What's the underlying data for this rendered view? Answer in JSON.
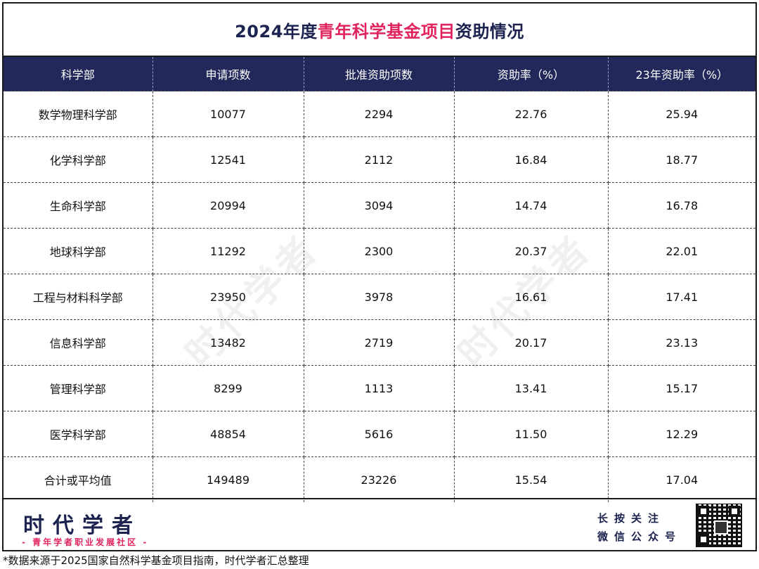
{
  "title": {
    "prefix": "2024年度",
    "highlight": "青年科学基金项目",
    "suffix": "资助情况"
  },
  "table": {
    "headers": [
      "科学部",
      "申请项数",
      "批准资助项数",
      "资助率（%）",
      "23年资助率（%）"
    ],
    "rows": [
      [
        "数学物理科学部",
        "10077",
        "2294",
        "22.76",
        "25.94"
      ],
      [
        "化学科学部",
        "12541",
        "2112",
        "16.84",
        "18.77"
      ],
      [
        "生命科学部",
        "20994",
        "3094",
        "14.74",
        "16.78"
      ],
      [
        "地球科学部",
        "11292",
        "2300",
        "20.37",
        "22.01"
      ],
      [
        "工程与材料科学部",
        "23950",
        "3978",
        "16.61",
        "17.41"
      ],
      [
        "信息科学部",
        "13482",
        "2719",
        "20.17",
        "23.13"
      ],
      [
        "管理科学部",
        "8299",
        "1113",
        "13.41",
        "15.17"
      ],
      [
        "医学科学部",
        "48854",
        "5616",
        "11.50",
        "12.29"
      ],
      [
        "合计或平均值",
        "149489",
        "23226",
        "15.54",
        "17.04"
      ]
    ]
  },
  "watermark": "时代学者",
  "footer": {
    "brand": "时代学者",
    "slogan": "- 青年学者职业发展社区 -",
    "follow_line1": "长按关注",
    "follow_line2": "微信公众号",
    "qr_icon": "qr-code-icon"
  },
  "note": "*数据来源于2025国家自然科学基金项目指南，时代学者汇总整理",
  "colors": {
    "navy": "#23285a",
    "accent": "#e0245e"
  }
}
